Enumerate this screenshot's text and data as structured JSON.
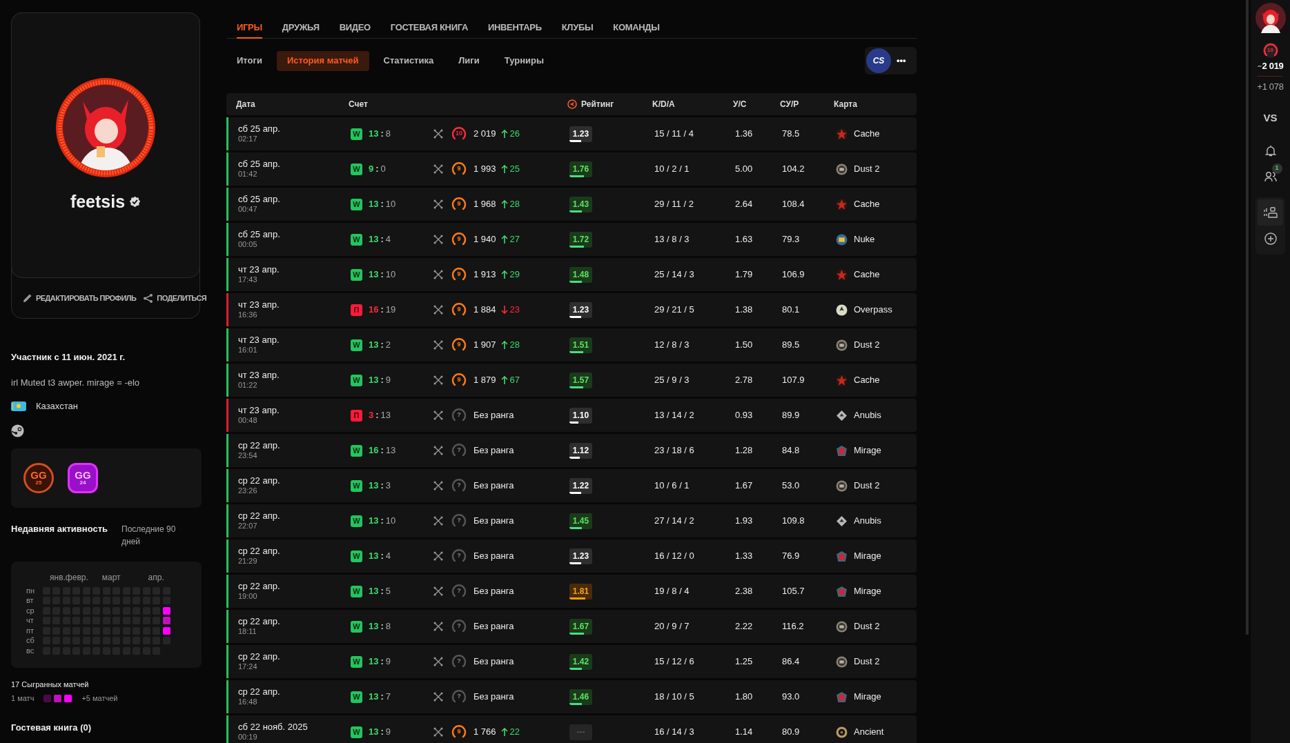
{
  "profile": {
    "name": "feetsis",
    "verified": true,
    "actions": [
      {
        "kind": "edit",
        "label": "РЕДАКТИРОВАТЬ ПРОФИЛЬ"
      },
      {
        "kind": "share",
        "label": "ПОДЕЛИТЬСЯ"
      }
    ],
    "member_since": "Участник с 11 июн. 2021 г.",
    "bio": "irl Muted t3 awper. mirage = -elo",
    "country": "Казахстан",
    "badges": [
      {
        "kind": "round",
        "title": "GG",
        "year": "25"
      },
      {
        "kind": "gear",
        "title": "GG",
        "year": "24"
      }
    ]
  },
  "activity": {
    "title": "Недавняя активность",
    "period": "Последние 90 дней",
    "months": [
      "янв.февр.",
      "март",
      "апр."
    ],
    "rows": [
      {
        "day": "пн",
        "cells": [
          {
            "color": "#262626"
          },
          {
            "color": "#262626"
          },
          {
            "color": "#262626"
          },
          {
            "color": "#262626"
          },
          {
            "color": "#262626"
          },
          {
            "color": "#262626"
          },
          {
            "color": "#262626"
          },
          {
            "color": "#262626"
          },
          {
            "color": "#262626"
          },
          {
            "color": "#262626"
          },
          {
            "color": "#262626"
          },
          {
            "color": "#262626"
          },
          {
            "color": "#262626"
          }
        ]
      },
      {
        "day": "вт",
        "cells": [
          {
            "color": "#262626"
          },
          {
            "color": "#262626"
          },
          {
            "color": "#262626"
          },
          {
            "color": "#262626"
          },
          {
            "color": "#262626"
          },
          {
            "color": "#262626"
          },
          {
            "color": "#262626"
          },
          {
            "color": "#262626"
          },
          {
            "color": "#262626"
          },
          {
            "color": "#262626"
          },
          {
            "color": "#262626"
          },
          {
            "color": "#262626"
          },
          {
            "color": "#262626"
          }
        ]
      },
      {
        "day": "ср",
        "cells": [
          {
            "color": "#262626"
          },
          {
            "color": "#262626"
          },
          {
            "color": "#262626"
          },
          {
            "color": "#262626"
          },
          {
            "color": "#262626"
          },
          {
            "color": "#262626"
          },
          {
            "color": "#262626"
          },
          {
            "color": "#262626"
          },
          {
            "color": "#262626"
          },
          {
            "color": "#262626"
          },
          {
            "color": "#262626"
          },
          {
            "color": "#262626"
          },
          {
            "color": "#ff00ff"
          }
        ]
      },
      {
        "day": "чт",
        "cells": [
          {
            "color": "#262626"
          },
          {
            "color": "#262626"
          },
          {
            "color": "#262626"
          },
          {
            "color": "#262626"
          },
          {
            "color": "#262626"
          },
          {
            "color": "#262626"
          },
          {
            "color": "#262626"
          },
          {
            "color": "#262626"
          },
          {
            "color": "#262626"
          },
          {
            "color": "#262626"
          },
          {
            "color": "#262626"
          },
          {
            "color": "#262626"
          },
          {
            "color": "#c010c0"
          }
        ]
      },
      {
        "day": "пт",
        "cells": [
          {
            "color": "#262626"
          },
          {
            "color": "#262626"
          },
          {
            "color": "#262626"
          },
          {
            "color": "#262626"
          },
          {
            "color": "#262626"
          },
          {
            "color": "#262626"
          },
          {
            "color": "#262626"
          },
          {
            "color": "#262626"
          },
          {
            "color": "#262626"
          },
          {
            "color": "#262626"
          },
          {
            "color": "#262626"
          },
          {
            "color": "#262626"
          },
          {
            "color": "#ff00ff"
          }
        ]
      },
      {
        "day": "сб",
        "cells": [
          {
            "color": "#262626"
          },
          {
            "color": "#262626"
          },
          {
            "color": "#262626"
          },
          {
            "color": "#262626"
          },
          {
            "color": "#262626"
          },
          {
            "color": "#262626"
          },
          {
            "color": "#262626"
          },
          {
            "color": "#262626"
          },
          {
            "color": "#262626"
          },
          {
            "color": "#262626"
          },
          {
            "color": "#262626"
          },
          {
            "color": "#262626"
          },
          {
            "color": "#262626"
          }
        ]
      },
      {
        "day": "вс",
        "cells": [
          {
            "color": "#262626"
          },
          {
            "color": "#262626"
          },
          {
            "color": "#262626"
          },
          {
            "color": "#262626"
          },
          {
            "color": "#262626"
          },
          {
            "color": "#262626"
          },
          {
            "color": "#262626"
          },
          {
            "color": "#262626"
          },
          {
            "color": "#262626"
          },
          {
            "color": "#262626"
          },
          {
            "color": "#262626"
          },
          {
            "color": "#262626"
          }
        ]
      }
    ],
    "total": "17 Сыгранных матчей",
    "legend_min": "1 матч",
    "legend": [
      {
        "color": "#4a0a4a"
      },
      {
        "color": "#c010c0"
      },
      {
        "color": "#ff00ff"
      }
    ],
    "legend_max": "+5 матчей"
  },
  "guestbook": "Гостевая книга (0)",
  "tabs": [
    {
      "label": "ИГРЫ",
      "selected": true
    },
    {
      "label": "ДРУЖЬЯ",
      "selected": false
    },
    {
      "label": "ВИДЕО",
      "selected": false
    },
    {
      "label": "ГОСТЕВАЯ КНИГА",
      "selected": false
    },
    {
      "label": "ИНВЕНТАРЬ",
      "selected": false
    },
    {
      "label": "КЛУБЫ",
      "selected": false
    },
    {
      "label": "КОМАНДЫ",
      "selected": false
    }
  ],
  "subtabs": [
    {
      "label": "Итоги",
      "selected": false
    },
    {
      "label": "История матчей",
      "selected": true
    },
    {
      "label": "Статистика",
      "selected": false
    },
    {
      "label": "Лиги",
      "selected": false
    },
    {
      "label": "Турниры",
      "selected": false
    }
  ],
  "game_switch": {
    "label": "CS",
    "more": "•••"
  },
  "table": {
    "columns": [
      "Дата",
      "Счет",
      "Рейтинг",
      "K/D/A",
      "У/С",
      "СУ/Р",
      "Карта"
    ],
    "rows": [
      {
        "date": "сб 25 апр.",
        "time": "02:17",
        "won": true,
        "result": "W",
        "score": [
          "13",
          ":",
          "8"
        ],
        "rank": {
          "kind": "ten",
          "mark": "10"
        },
        "elo": "2 019",
        "change": {
          "up": true,
          "value": "26"
        },
        "rating": {
          "value": "1.23",
          "kind": "neutral",
          "level": 0.5
        },
        "kda": "15 / 11 / 4",
        "us": "1.36",
        "sur": "78.5",
        "map": {
          "name": "Cache",
          "kind": "star"
        }
      },
      {
        "date": "сб 25 апр.",
        "time": "01:42",
        "won": true,
        "result": "W",
        "score": [
          "9",
          ":",
          "0"
        ],
        "rank": {
          "kind": "nine",
          "mark": "9"
        },
        "elo": "1 993",
        "change": {
          "up": true,
          "value": "25"
        },
        "rating": {
          "value": "1.76",
          "kind": "good",
          "level": 0.65
        },
        "kda": "10 / 2 / 1",
        "us": "5.00",
        "sur": "104.2",
        "map": {
          "name": "Dust 2",
          "kind": "coin"
        }
      },
      {
        "date": "сб 25 апр.",
        "time": "00:47",
        "won": true,
        "result": "W",
        "score": [
          "13",
          ":",
          "10"
        ],
        "rank": {
          "kind": "nine",
          "mark": "9"
        },
        "elo": "1 968",
        "change": {
          "up": true,
          "value": "28"
        },
        "rating": {
          "value": "1.43",
          "kind": "good",
          "level": 0.55
        },
        "kda": "29 / 11 / 2",
        "us": "2.64",
        "sur": "108.4",
        "map": {
          "name": "Cache",
          "kind": "star"
        }
      },
      {
        "date": "сб 25 апр.",
        "time": "00:05",
        "won": true,
        "result": "W",
        "score": [
          "13",
          ":",
          "4"
        ],
        "rank": {
          "kind": "nine",
          "mark": "9"
        },
        "elo": "1 940",
        "change": {
          "up": true,
          "value": "27"
        },
        "rating": {
          "value": "1.72",
          "kind": "good",
          "level": 0.65
        },
        "kda": "13 / 8 / 3",
        "us": "1.63",
        "sur": "79.3",
        "map": {
          "name": "Nuke",
          "kind": "globe"
        }
      },
      {
        "date": "чт 23 апр.",
        "time": "17:43",
        "won": true,
        "result": "W",
        "score": [
          "13",
          ":",
          "10"
        ],
        "rank": {
          "kind": "nine",
          "mark": "9"
        },
        "elo": "1 913",
        "change": {
          "up": true,
          "value": "29"
        },
        "rating": {
          "value": "1.48",
          "kind": "good",
          "level": 0.55
        },
        "kda": "25 / 14 / 3",
        "us": "1.79",
        "sur": "106.9",
        "map": {
          "name": "Cache",
          "kind": "star"
        }
      },
      {
        "date": "чт 23 апр.",
        "time": "16:36",
        "won": false,
        "result": "П",
        "score": [
          "16",
          ":",
          "19"
        ],
        "rank": {
          "kind": "nine",
          "mark": "9"
        },
        "elo": "1 884",
        "change": {
          "up": false,
          "value": "23"
        },
        "rating": {
          "value": "1.23",
          "kind": "neutral",
          "level": 0.5
        },
        "kda": "29 / 21 / 5",
        "us": "1.38",
        "sur": "80.1",
        "map": {
          "name": "Overpass",
          "kind": "leaf"
        }
      },
      {
        "date": "чт 23 апр.",
        "time": "16:01",
        "won": true,
        "result": "W",
        "score": [
          "13",
          ":",
          "2"
        ],
        "rank": {
          "kind": "nine",
          "mark": "9"
        },
        "elo": "1 907",
        "change": {
          "up": true,
          "value": "28"
        },
        "rating": {
          "value": "1.51",
          "kind": "good",
          "level": 0.6
        },
        "kda": "12 / 8 / 3",
        "us": "1.50",
        "sur": "89.5",
        "map": {
          "name": "Dust 2",
          "kind": "coin"
        }
      },
      {
        "date": "чт 23 апр.",
        "time": "01:22",
        "won": true,
        "result": "W",
        "score": [
          "13",
          ":",
          "9"
        ],
        "rank": {
          "kind": "nine",
          "mark": "9"
        },
        "elo": "1 879",
        "change": {
          "up": true,
          "value": "67"
        },
        "rating": {
          "value": "1.57",
          "kind": "good",
          "level": 0.6
        },
        "kda": "25 / 9 / 3",
        "us": "2.78",
        "sur": "107.9",
        "map": {
          "name": "Cache",
          "kind": "star"
        }
      },
      {
        "date": "чт 23 апр.",
        "time": "00:48",
        "won": false,
        "result": "П",
        "score": [
          "3",
          ":",
          "13"
        ],
        "rank": {
          "kind": "unranked",
          "mark": "?"
        },
        "elo": "Без ранга",
        "rating": {
          "value": "1.10",
          "kind": "neutral",
          "level": 0.4
        },
        "kda": "13 / 14 / 2",
        "us": "0.93",
        "sur": "89.9",
        "map": {
          "name": "Anubis",
          "kind": "diamond"
        }
      },
      {
        "date": "ср 22 апр.",
        "time": "23:54",
        "won": true,
        "result": "W",
        "score": [
          "16",
          ":",
          "13"
        ],
        "rank": {
          "kind": "unranked",
          "mark": "?"
        },
        "elo": "Без ранга",
        "rating": {
          "value": "1.12",
          "kind": "neutral",
          "level": 0.45
        },
        "kda": "23 / 18 / 6",
        "us": "1.28",
        "sur": "84.8",
        "map": {
          "name": "Mirage",
          "kind": "shield"
        }
      },
      {
        "date": "ср 22 апр.",
        "time": "23:26",
        "won": true,
        "result": "W",
        "score": [
          "13",
          ":",
          "3"
        ],
        "rank": {
          "kind": "unranked",
          "mark": "?"
        },
        "elo": "Без ранга",
        "rating": {
          "value": "1.22",
          "kind": "neutral",
          "level": 0.5
        },
        "kda": "10 / 6 / 1",
        "us": "1.67",
        "sur": "53.0",
        "map": {
          "name": "Dust 2",
          "kind": "coin"
        }
      },
      {
        "date": "ср 22 апр.",
        "time": "22:07",
        "won": true,
        "result": "W",
        "score": [
          "13",
          ":",
          "10"
        ],
        "rank": {
          "kind": "unranked",
          "mark": "?"
        },
        "elo": "Без ранга",
        "rating": {
          "value": "1.45",
          "kind": "good",
          "level": 0.55
        },
        "kda": "27 / 14 / 2",
        "us": "1.93",
        "sur": "109.8",
        "map": {
          "name": "Anubis",
          "kind": "diamond"
        }
      },
      {
        "date": "ср 22 апр.",
        "time": "21:29",
        "won": true,
        "result": "W",
        "score": [
          "13",
          ":",
          "4"
        ],
        "rank": {
          "kind": "unranked",
          "mark": "?"
        },
        "elo": "Без ранга",
        "rating": {
          "value": "1.23",
          "kind": "neutral",
          "level": 0.5
        },
        "kda": "16 / 12 / 0",
        "us": "1.33",
        "sur": "76.9",
        "map": {
          "name": "Mirage",
          "kind": "shield"
        }
      },
      {
        "date": "ср 22 апр.",
        "time": "19:00",
        "won": true,
        "result": "W",
        "score": [
          "13",
          ":",
          "5"
        ],
        "rank": {
          "kind": "unranked",
          "mark": "?"
        },
        "elo": "Без ранга",
        "rating": {
          "value": "1.81",
          "kind": "great",
          "level": 0.7
        },
        "kda": "19 / 8 / 4",
        "us": "2.38",
        "sur": "105.7",
        "map": {
          "name": "Mirage",
          "kind": "shield"
        }
      },
      {
        "date": "ср 22 апр.",
        "time": "18:11",
        "won": true,
        "result": "W",
        "score": [
          "13",
          ":",
          "8"
        ],
        "rank": {
          "kind": "unranked",
          "mark": "?"
        },
        "elo": "Без ранга",
        "rating": {
          "value": "1.67",
          "kind": "good",
          "level": 0.65
        },
        "kda": "20 / 9 / 7",
        "us": "2.22",
        "sur": "116.2",
        "map": {
          "name": "Dust 2",
          "kind": "coin"
        }
      },
      {
        "date": "ср 22 апр.",
        "time": "17:24",
        "won": true,
        "result": "W",
        "score": [
          "13",
          ":",
          "9"
        ],
        "rank": {
          "kind": "unranked",
          "mark": "?"
        },
        "elo": "Без ранга",
        "rating": {
          "value": "1.42",
          "kind": "good",
          "level": 0.55
        },
        "kda": "15 / 12 / 6",
        "us": "1.25",
        "sur": "86.4",
        "map": {
          "name": "Dust 2",
          "kind": "coin"
        }
      },
      {
        "date": "ср 22 апр.",
        "time": "16:48",
        "won": true,
        "result": "W",
        "score": [
          "13",
          ":",
          "7"
        ],
        "rank": {
          "kind": "unranked",
          "mark": "?"
        },
        "elo": "Без ранга",
        "rating": {
          "value": "1.46",
          "kind": "good",
          "level": 0.55
        },
        "kda": "18 / 10 / 5",
        "us": "1.80",
        "sur": "93.0",
        "map": {
          "name": "Mirage",
          "kind": "shield"
        }
      },
      {
        "date": "сб 22 нояб. 2025",
        "time": "00:19",
        "won": true,
        "result": "W",
        "score": [
          "13",
          ":",
          "9"
        ],
        "rank": {
          "kind": "nine",
          "mark": "9"
        },
        "elo": "1 766",
        "change": {
          "up": true,
          "value": "22"
        },
        "rating": {
          "value": "---",
          "kind": "none"
        },
        "kda": "16 / 14 / 3",
        "us": "1.14",
        "sur": "80.9",
        "map": {
          "name": "Ancient",
          "kind": "wreath"
        }
      }
    ]
  },
  "sidebar": {
    "rank": {
      "kind": "ten",
      "mark": "10"
    },
    "elo": "2 019",
    "gain": "+1 078",
    "vs": "VS",
    "friend_requests": "1"
  }
}
